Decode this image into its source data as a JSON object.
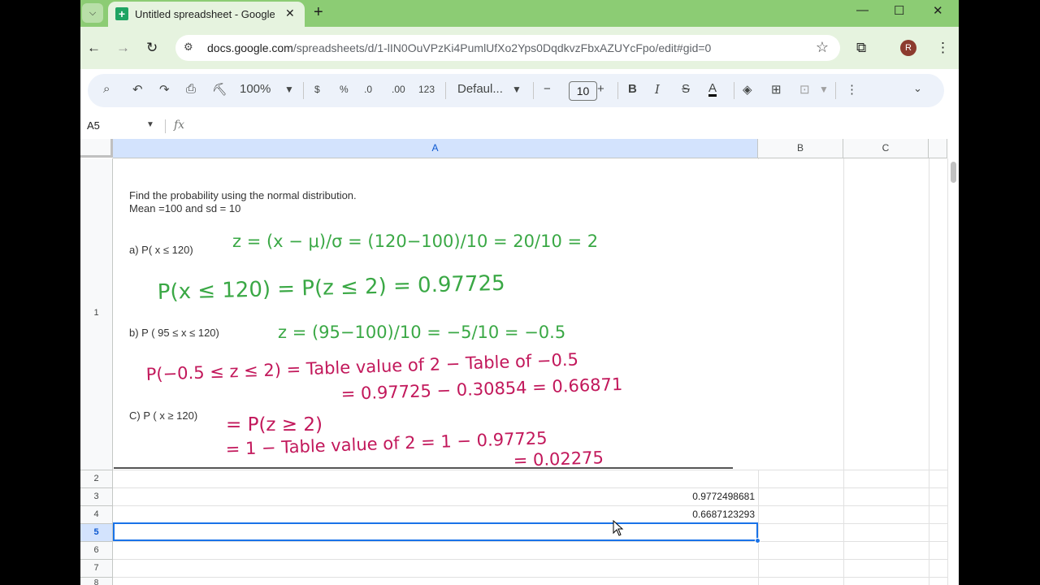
{
  "browser": {
    "tab_title": "Untitled spreadsheet - Google Sheets",
    "url_host": "docs.google.com",
    "url_path": "/spreadsheets/d/1-lIN0OuVPzKi4PumlUfXo2Yps0DqdkvzFbxAZUYcFpo/edit#gid=0",
    "avatar_letter": "R",
    "new_tab": "+",
    "minimize": "—",
    "maximize": "☐",
    "close": "✕"
  },
  "toolbar": {
    "zoom": "100%",
    "currency": "$",
    "percent": "%",
    "dec_decrease": ".0",
    "dec_increase": ".00",
    "number_format": "123",
    "font_name": "Defaul...",
    "font_size": "10",
    "minus": "−",
    "plus": "+",
    "bold": "B",
    "italic": "I",
    "strike": "S",
    "text_color": "A"
  },
  "formula_bar": {
    "name_box": "A5",
    "fx": "fx",
    "value": ""
  },
  "columns": [
    "A",
    "B",
    "C"
  ],
  "rows": [
    "1",
    "2",
    "3",
    "4",
    "5",
    "6",
    "7",
    "8"
  ],
  "cells": {
    "A3": "0.9772498681",
    "A4": "0.6687123293"
  },
  "image": {
    "line1": "Find the probability using the normal distribution.",
    "line2": "Mean =100  and sd = 10",
    "a_label": "a) P( x ≤ 120)",
    "a_z": "z = (x − μ)/σ = (120−100)/10 = 20/10 = 2",
    "a_result": "P(x ≤ 120) = P(z ≤ 2) = 0.97725",
    "b_label": "b)  P ( 95 ≤ x ≤ 120)",
    "b_z": "z = (95−100)/10 = −5/10 = −0.5",
    "b_line1": "P(−0.5 ≤ z ≤ 2) = Table value of 2 − Table of −0.5",
    "b_line2": "= 0.97725 − 0.30854 = 0.66871",
    "c_label": "C) P ( x ≥ 120)",
    "c_line1": "= P(z ≥ 2)",
    "c_line2": "= 1 − Table value of 2 = 1 − 0.97725",
    "c_line3": "= 0.02275"
  },
  "colors": {
    "tab_strip": "#8ccc74",
    "green_ink": "#3aa845",
    "red_ink": "#c2185b",
    "selection": "#1a73e8"
  }
}
